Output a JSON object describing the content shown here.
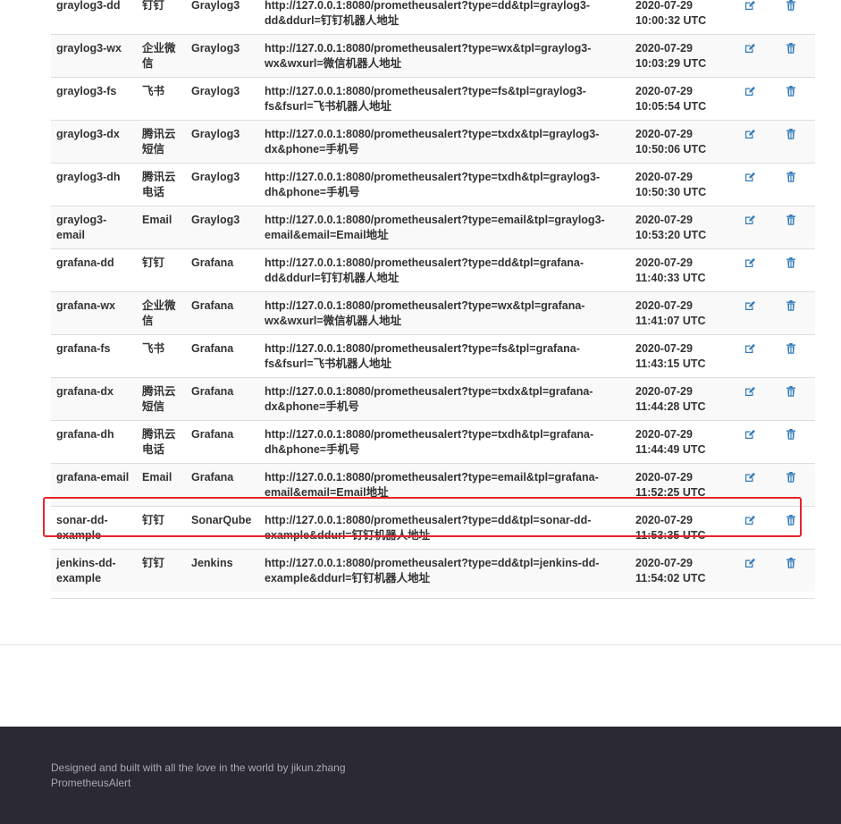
{
  "accent": "#337ab7",
  "highlight_color": "#e8232b",
  "rows": [
    {
      "name": "graylog3-dd",
      "type": "钉钉",
      "source": "Graylog3",
      "url": "http://127.0.0.1:8080/prometheusalert?type=dd&tpl=graylog3-dd&ddurl=钉钉机器人地址",
      "time": "2020-07-29 10:00:32 UTC"
    },
    {
      "name": "graylog3-wx",
      "type": "企业微信",
      "source": "Graylog3",
      "url": "http://127.0.0.1:8080/prometheusalert?type=wx&tpl=graylog3-wx&wxurl=微信机器人地址",
      "time": "2020-07-29 10:03:29 UTC"
    },
    {
      "name": "graylog3-fs",
      "type": "飞书",
      "source": "Graylog3",
      "url": "http://127.0.0.1:8080/prometheusalert?type=fs&tpl=graylog3-fs&fsurl=飞书机器人地址",
      "time": "2020-07-29 10:05:54 UTC"
    },
    {
      "name": "graylog3-dx",
      "type": "腾讯云短信",
      "source": "Graylog3",
      "url": "http://127.0.0.1:8080/prometheusalert?type=txdx&tpl=graylog3-dx&phone=手机号",
      "time": "2020-07-29 10:50:06 UTC"
    },
    {
      "name": "graylog3-dh",
      "type": "腾讯云电话",
      "source": "Graylog3",
      "url": "http://127.0.0.1:8080/prometheusalert?type=txdh&tpl=graylog3-dh&phone=手机号",
      "time": "2020-07-29 10:50:30 UTC"
    },
    {
      "name": "graylog3-email",
      "type": "Email",
      "source": "Graylog3",
      "url": "http://127.0.0.1:8080/prometheusalert?type=email&tpl=graylog3-email&email=Email地址",
      "time": "2020-07-29 10:53:20 UTC"
    },
    {
      "name": "grafana-dd",
      "type": "钉钉",
      "source": "Grafana",
      "url": "http://127.0.0.1:8080/prometheusalert?type=dd&tpl=grafana-dd&ddurl=钉钉机器人地址",
      "time": "2020-07-29 11:40:33 UTC"
    },
    {
      "name": "grafana-wx",
      "type": "企业微信",
      "source": "Grafana",
      "url": "http://127.0.0.1:8080/prometheusalert?type=wx&tpl=grafana-wx&wxurl=微信机器人地址",
      "time": "2020-07-29 11:41:07 UTC"
    },
    {
      "name": "grafana-fs",
      "type": "飞书",
      "source": "Grafana",
      "url": "http://127.0.0.1:8080/prometheusalert?type=fs&tpl=grafana-fs&fsurl=飞书机器人地址",
      "time": "2020-07-29 11:43:15 UTC"
    },
    {
      "name": "grafana-dx",
      "type": "腾讯云短信",
      "source": "Grafana",
      "url": "http://127.0.0.1:8080/prometheusalert?type=txdx&tpl=grafana-dx&phone=手机号",
      "time": "2020-07-29 11:44:28 UTC"
    },
    {
      "name": "grafana-dh",
      "type": "腾讯云电话",
      "source": "Grafana",
      "url": "http://127.0.0.1:8080/prometheusalert?type=txdh&tpl=grafana-dh&phone=手机号",
      "time": "2020-07-29 11:44:49 UTC"
    },
    {
      "name": "grafana-email",
      "type": "Email",
      "source": "Grafana",
      "url": "http://127.0.0.1:8080/prometheusalert?type=email&tpl=grafana-email&email=Email地址",
      "time": "2020-07-29 11:52:25 UTC"
    },
    {
      "name": "sonar-dd-example",
      "type": "钉钉",
      "source": "SonarQube",
      "url": "http://127.0.0.1:8080/prometheusalert?type=dd&tpl=sonar-dd-example&ddurl=钉钉机器人地址",
      "time": "2020-07-29 11:53:35 UTC"
    },
    {
      "name": "jenkins-dd-example",
      "type": "钉钉",
      "source": "Jenkins",
      "url": "http://127.0.0.1:8080/prometheusalert?type=dd&tpl=jenkins-dd-example&ddurl=钉钉机器人地址",
      "time": "2020-07-29 11:54:02 UTC"
    }
  ],
  "row_icons": {
    "edit": "edit-icon",
    "delete": "trash-icon"
  },
  "footer": {
    "line1": "Designed and built with all the love in the world by jikun.zhang",
    "line2": "PrometheusAlert"
  }
}
